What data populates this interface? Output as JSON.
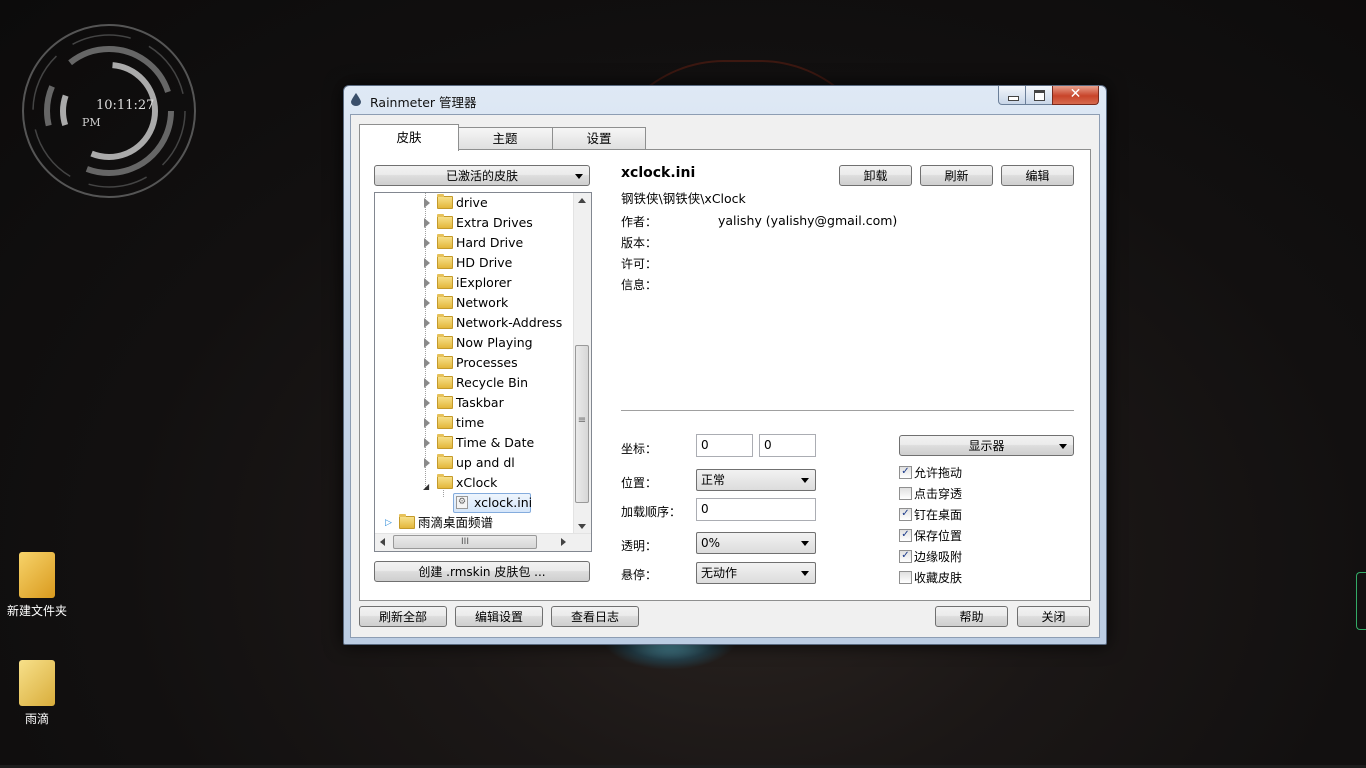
{
  "desktop": {
    "clock": {
      "time": "10:11:27",
      "ampm": "PM"
    },
    "icons": [
      {
        "label": "新建文件夹"
      },
      {
        "label": "雨滴"
      }
    ]
  },
  "window": {
    "title": "Rainmeter 管理器",
    "tabs": [
      {
        "label": "皮肤"
      },
      {
        "label": "主题"
      },
      {
        "label": "设置"
      }
    ],
    "skins_dropdown": "已激活的皮肤",
    "tree": {
      "items": [
        {
          "label": "drive"
        },
        {
          "label": "Extra Drives"
        },
        {
          "label": "Hard Drive"
        },
        {
          "label": "HD Drive"
        },
        {
          "label": "iExplorer"
        },
        {
          "label": "Network"
        },
        {
          "label": "Network-Address"
        },
        {
          "label": "Now Playing"
        },
        {
          "label": "Processes"
        },
        {
          "label": "Recycle Bin"
        },
        {
          "label": "Taskbar"
        },
        {
          "label": "time"
        },
        {
          "label": "Time & Date"
        },
        {
          "label": "up and dl"
        },
        {
          "label": "xClock"
        },
        {
          "label": "xclock.ini"
        },
        {
          "label": "雨滴桌面频谱"
        }
      ],
      "hscroll_grip": "III",
      "vscroll_grip": "≡"
    },
    "create_package_button": "创建 .rmskin 皮肤包 ...",
    "skin": {
      "name": "xclock.ini",
      "path": "钢铁侠\\钢铁侠\\xClock",
      "author_label": "作者：",
      "author_value": "yalishy (yalishy@gmail.com)",
      "version_label": "版本：",
      "license_label": "许可：",
      "info_label": "信息："
    },
    "actions": {
      "unload": "卸载",
      "refresh": "刷新",
      "edit": "编辑"
    },
    "settings": {
      "coord_label": "坐标：",
      "x": "0",
      "y": "0",
      "monitor_dropdown": "显示器",
      "position_label": "位置：",
      "position_value": "正常",
      "load_order_label": "加载顺序：",
      "load_order_value": "0",
      "transparency_label": "透明：",
      "transparency_value": "0%",
      "hover_label": "悬停：",
      "hover_value": "无动作",
      "checkboxes": [
        {
          "label": "允许拖动",
          "checked": "✓"
        },
        {
          "label": "点击穿透",
          "checked": ""
        },
        {
          "label": "钉在桌面",
          "checked": "✓"
        },
        {
          "label": "保存位置",
          "checked": "✓"
        },
        {
          "label": "边缘吸附",
          "checked": "✓"
        },
        {
          "label": "收藏皮肤",
          "checked": ""
        }
      ]
    },
    "bottom": {
      "refresh_all": "刷新全部",
      "edit_settings": "编辑设置",
      "view_log": "查看日志",
      "help": "帮助",
      "close": "关闭"
    }
  }
}
